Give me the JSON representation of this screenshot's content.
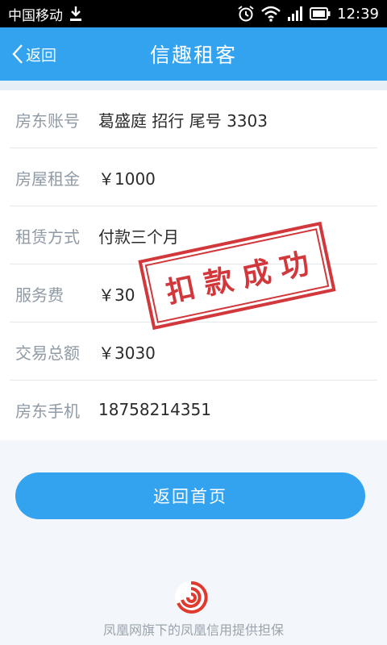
{
  "status_bar": {
    "carrier": "中国移动",
    "time": "12:39"
  },
  "header": {
    "back_label": "返回",
    "title": "信趣租客"
  },
  "details": [
    {
      "label": "房东账号",
      "value": "葛盛庭 招行 尾号 3303"
    },
    {
      "label": "房屋租金",
      "value": "￥1000"
    },
    {
      "label": "租赁方式",
      "value": "付款三个月"
    },
    {
      "label": "服务费",
      "value": "￥30"
    },
    {
      "label": "交易总额",
      "value": "￥3030"
    },
    {
      "label": "房东手机",
      "value": "18758214351"
    }
  ],
  "stamp": {
    "text": "扣款成功",
    "color": "#d2373b"
  },
  "home_button": {
    "label": "返回首页"
  },
  "footer": {
    "text": "凤凰网旗下的凤凰信用提供担保"
  },
  "colors": {
    "accent": "#33a2ef",
    "stamp": "#d2373b"
  }
}
